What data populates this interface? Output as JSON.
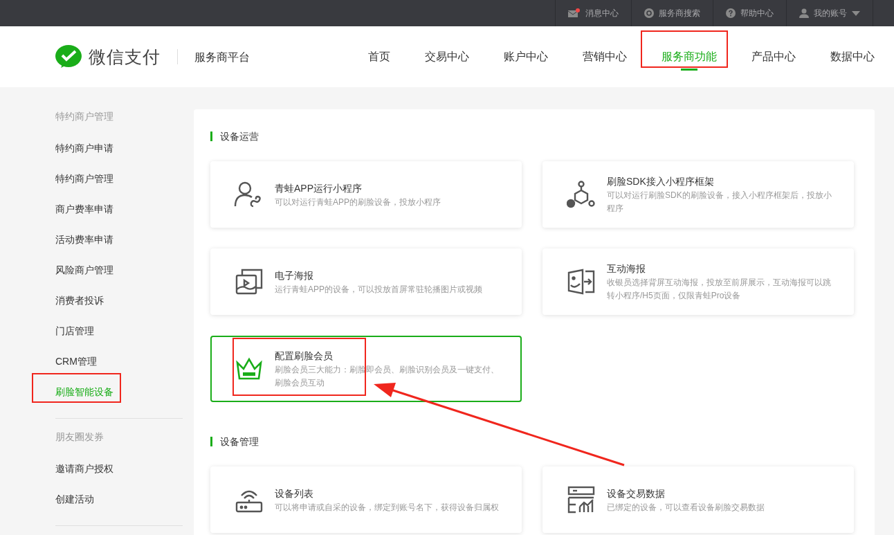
{
  "top_bar": [
    {
      "kind": "mail",
      "label": "消息中心",
      "unread": true
    },
    {
      "kind": "search",
      "label": "服务商搜索"
    },
    {
      "kind": "help",
      "label": "帮助中心"
    },
    {
      "kind": "account",
      "label": "我的账号"
    }
  ],
  "brand": {
    "name": "微信支付",
    "platform": "服务商平台"
  },
  "nav": [
    {
      "label": "首页",
      "selected": false,
      "highlighted": false
    },
    {
      "label": "交易中心",
      "selected": false,
      "highlighted": false
    },
    {
      "label": "账户中心",
      "selected": false,
      "highlighted": false
    },
    {
      "label": "营销中心",
      "selected": false,
      "highlighted": false
    },
    {
      "label": "服务商功能",
      "selected": true,
      "highlighted": true
    },
    {
      "label": "产品中心",
      "selected": false,
      "highlighted": false
    },
    {
      "label": "数据中心",
      "selected": false,
      "highlighted": false
    }
  ],
  "sidebar": {
    "groups": [
      {
        "title": "特约商户管理",
        "items": [
          {
            "label": "特约商户申请",
            "selected": false,
            "highlighted": false
          },
          {
            "label": "特约商户管理",
            "selected": false,
            "highlighted": false
          },
          {
            "label": "商户费率申请",
            "selected": false,
            "highlighted": false
          },
          {
            "label": "活动费率申请",
            "selected": false,
            "highlighted": false
          },
          {
            "label": "风险商户管理",
            "selected": false,
            "highlighted": false
          },
          {
            "label": "消费者投诉",
            "selected": false,
            "highlighted": false
          },
          {
            "label": "门店管理",
            "selected": false,
            "highlighted": false
          },
          {
            "label": "CRM管理",
            "selected": false,
            "highlighted": false
          },
          {
            "label": "刷脸智能设备",
            "selected": true,
            "highlighted": true
          }
        ]
      },
      {
        "title": "朋友圈发券",
        "items": [
          {
            "label": "邀请商户授权",
            "selected": false,
            "highlighted": false
          },
          {
            "label": "创建活动",
            "selected": false,
            "highlighted": false
          }
        ]
      }
    ]
  },
  "sections": [
    {
      "title": "设备运营",
      "cards": [
        {
          "kind": "person-link",
          "title": "青蛙APP运行小程序",
          "description": "可以对运行青蛙APP的刷脸设备，投放小程序",
          "selected": false,
          "highlighted": false
        },
        {
          "kind": "network",
          "title": "刷脸SDK接入小程序框架",
          "description": "可以对运行刷脸SDK的刷脸设备，接入小程序框架后，投放小程序",
          "selected": false,
          "highlighted": false
        },
        {
          "kind": "poster",
          "title": "电子海报",
          "description": "运行青蛙APP的设备，可以投放首屏常驻轮播图片或视频",
          "selected": false,
          "highlighted": false
        },
        {
          "kind": "interactive",
          "title": "互动海报",
          "description": "收银员选择背屏互动海报，投放至前屏展示，互动海报可以跳转小程序/H5页面，仅限青蛙Pro设备",
          "selected": false,
          "highlighted": false
        },
        {
          "kind": "crown",
          "title": "配置刷脸会员",
          "description": "刷脸会员三大能力：刷脸即会员、刷脸识别会员及一键支付、刷脸会员互动",
          "selected": true,
          "highlighted": true
        }
      ]
    },
    {
      "title": "设备管理",
      "cards": [
        {
          "kind": "router",
          "title": "设备列表",
          "description": "可以将申请或自采的设备，绑定到账号名下，获得设备归属权",
          "selected": false,
          "highlighted": false
        },
        {
          "kind": "server",
          "title": "设备交易数据",
          "description": "已绑定的设备，可以查看设备刷脸交易数据",
          "selected": false,
          "highlighted": false
        }
      ]
    }
  ]
}
